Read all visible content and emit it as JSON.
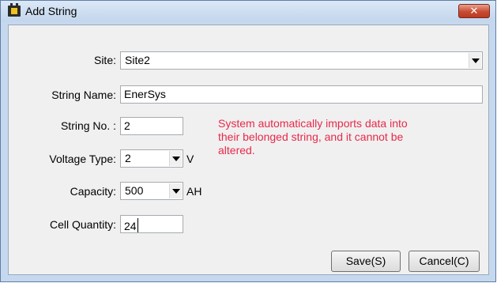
{
  "window": {
    "title": "Add String",
    "close_label": "✕"
  },
  "form": {
    "site": {
      "label": "Site:",
      "value": "Site2"
    },
    "string_name": {
      "label": "String Name:",
      "value": "EnerSys"
    },
    "string_no": {
      "label": "String No. :",
      "value": "2"
    },
    "voltage_type": {
      "label": "Voltage Type:",
      "value": "2",
      "unit": "V"
    },
    "capacity": {
      "label": "Capacity:",
      "value": "500",
      "unit": "AH"
    },
    "cell_quantity": {
      "label": "Cell Quantity:",
      "value": "24"
    },
    "note": "System automatically imports data into their belonged string, and it cannot be altered."
  },
  "buttons": {
    "save": "Save(S)",
    "cancel": "Cancel(C)"
  },
  "colors": {
    "note": "#e8294a",
    "title_bar": "#c5d8ee",
    "close_button": "#c74b32"
  }
}
